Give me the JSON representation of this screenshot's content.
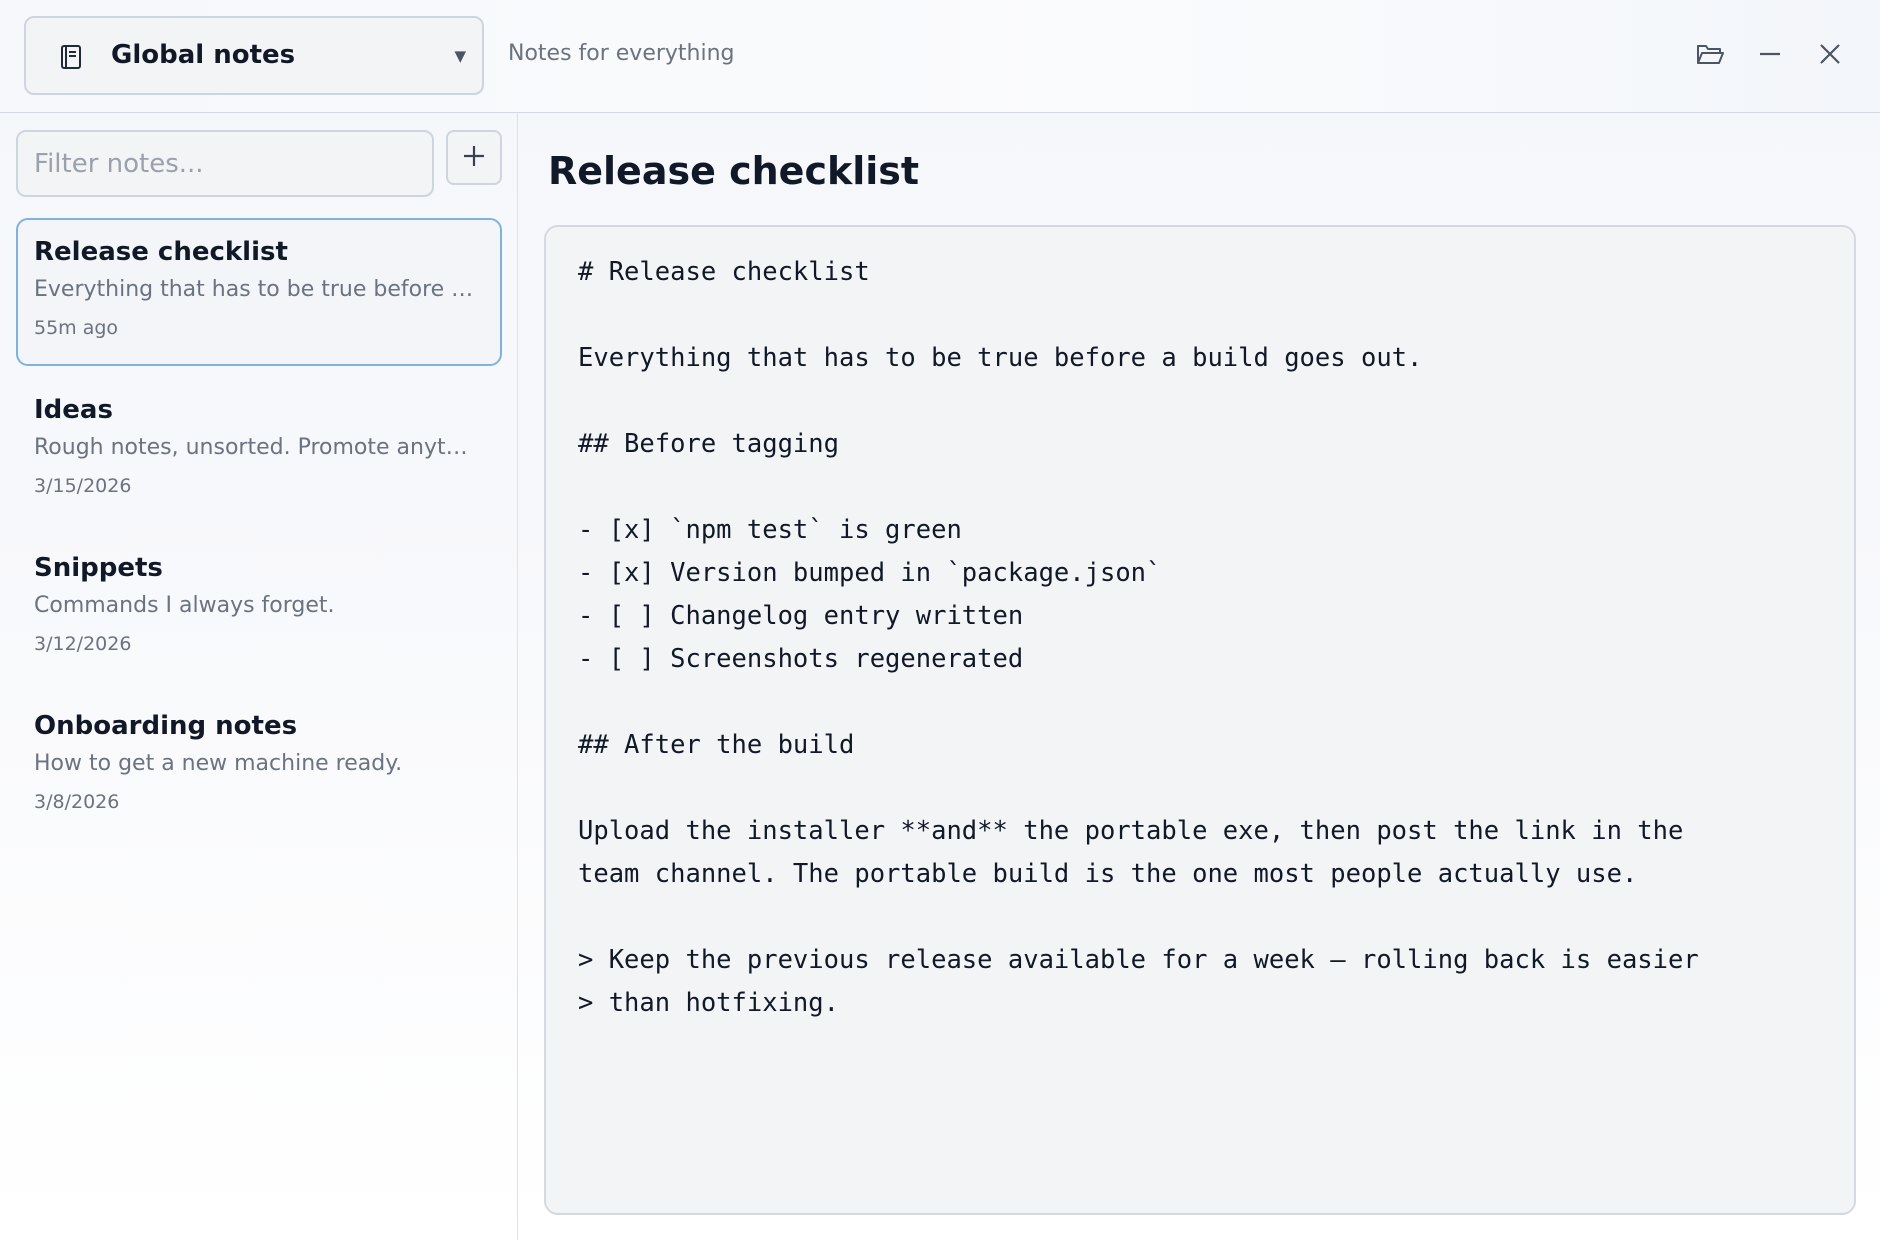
{
  "header": {
    "notebook_name": "Global notes",
    "notebook_description": "Notes for everything",
    "icons": {
      "notebook": "notebook-icon",
      "dropdown": "chevron-down-icon",
      "open_folder": "folder-open-icon",
      "minimize": "minimize-icon",
      "close": "close-icon"
    }
  },
  "sidebar": {
    "filter_placeholder": "Filter notes...",
    "filter_value": "",
    "add_icon": "plus-icon",
    "notes": [
      {
        "title": "Release checklist",
        "preview": "Everything that has to be true before a build goes out.",
        "date": "55m ago",
        "active": true
      },
      {
        "title": "Ideas",
        "preview": "Rough notes, unsorted. Promote anything worth keeping.",
        "date": "3/15/2026",
        "active": false
      },
      {
        "title": "Snippets",
        "preview": "Commands I always forget.",
        "date": "3/12/2026",
        "active": false
      },
      {
        "title": "Onboarding notes",
        "preview": "How to get a new machine ready.",
        "date": "3/8/2026",
        "active": false
      }
    ]
  },
  "editor": {
    "title": "Release checklist",
    "content": "# Release checklist\n\nEverything that has to be true before a build goes out.\n\n## Before tagging\n\n- [x] `npm test` is green\n- [x] Version bumped in `package.json`\n- [ ] Changelog entry written\n- [ ] Screenshots regenerated\n\n## After the build\n\nUpload the installer **and** the portable exe, then post the link in the\nteam channel. The portable build is the one most people actually use.\n\n> Keep the previous release available for a week — rolling back is easier\n> than hotfixing."
  },
  "colors": {
    "accent_border": "#7fb3df",
    "text_primary": "#111827",
    "text_muted": "#6b7280"
  }
}
